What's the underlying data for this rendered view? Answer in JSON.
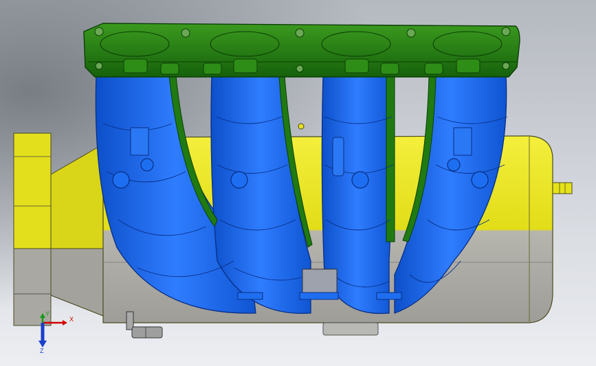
{
  "colors": {
    "background_top": "#b8bcc3",
    "background_bottom": "#e7e9ee",
    "flange": "#1f7a12",
    "flange_edge": "#0b3f06",
    "runner": "#1464e6",
    "runner_light": "#3f8cff",
    "runner_edge": "#082e86",
    "plenum": "#e6e21a",
    "plenum_shadow": "#a7a6a0",
    "plenum_edge": "#4a4a20",
    "axis_x": "#d00000",
    "axis_y": "#1a9a1a",
    "axis_z": "#1a3fcc"
  },
  "view_triad": {
    "x_label": "X",
    "y_label": "Y",
    "z_label": "Z"
  },
  "model": {
    "parts": [
      "intake-manifold-flange",
      "runner",
      "plenum",
      "throttle-body-flange",
      "vacuum-nipple",
      "sensor-fitting"
    ],
    "runner_count": 4,
    "flange_bolt_holes": 8
  }
}
